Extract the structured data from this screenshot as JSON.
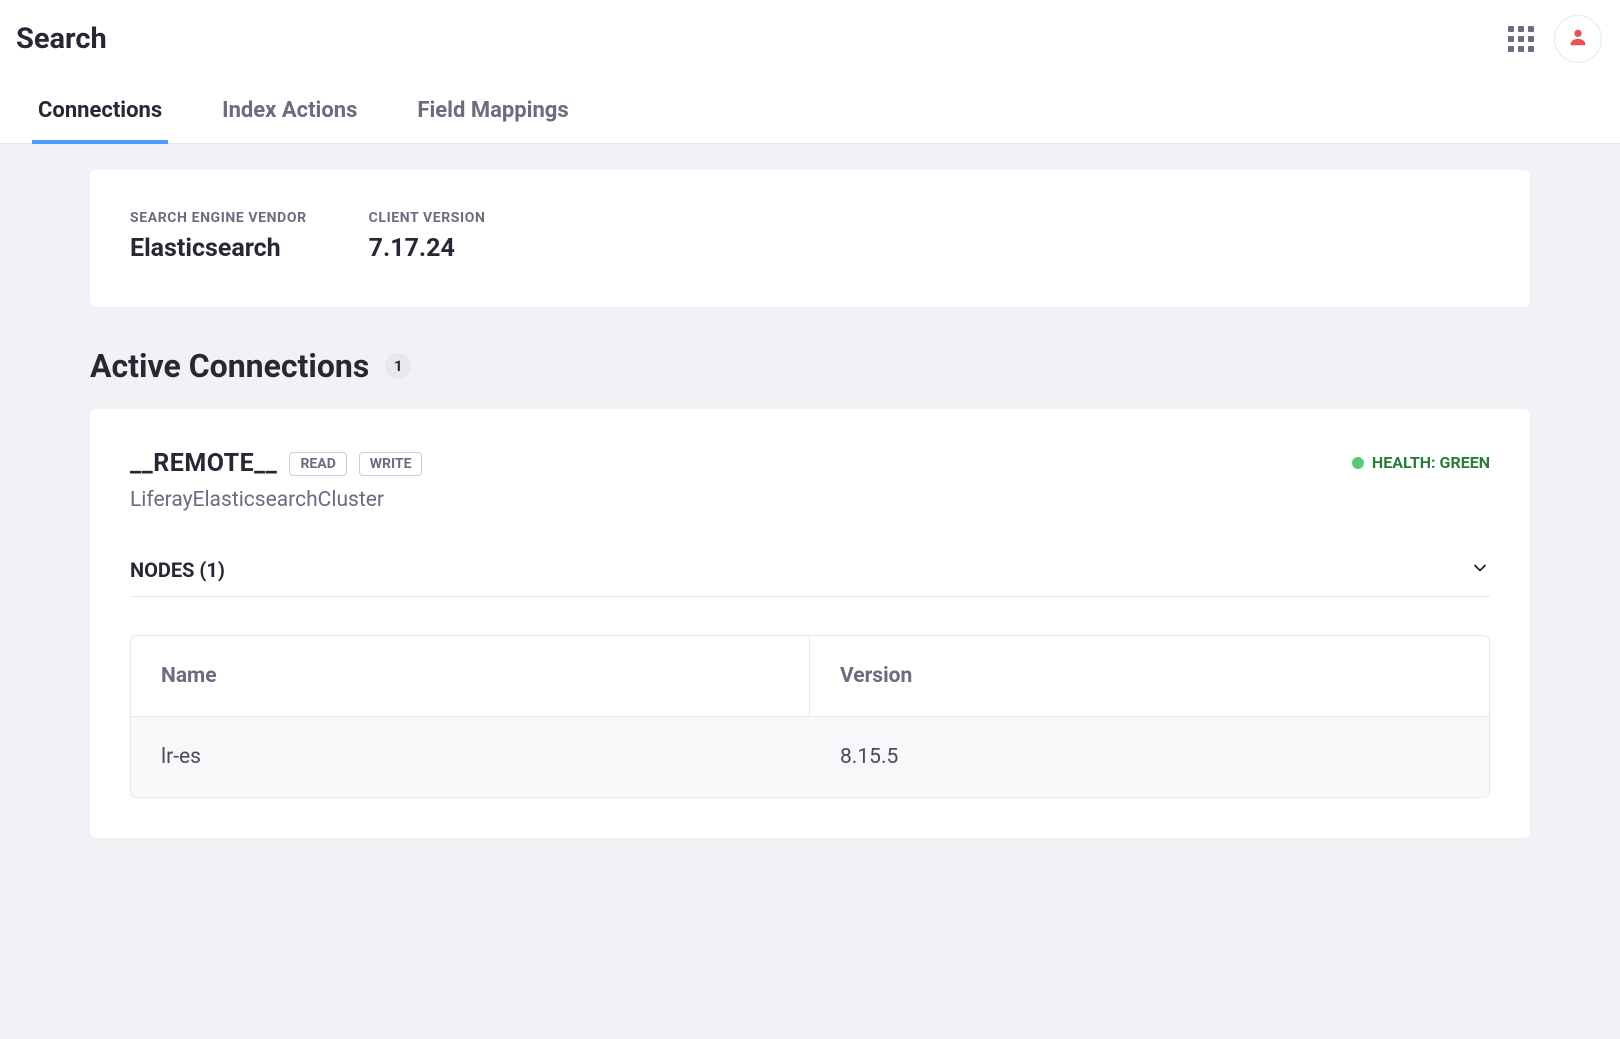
{
  "header": {
    "title": "Search"
  },
  "tabs": [
    {
      "label": "Connections",
      "active": true
    },
    {
      "label": "Index Actions",
      "active": false
    },
    {
      "label": "Field Mappings",
      "active": false
    }
  ],
  "engine": {
    "vendor_label": "SEARCH ENGINE VENDOR",
    "vendor_value": "Elasticsearch",
    "client_label": "CLIENT VERSION",
    "client_value": "7.17.24"
  },
  "active_connections": {
    "title": "Active Connections",
    "count": "1"
  },
  "connection": {
    "name": "__REMOTE__",
    "pills": [
      "READ",
      "WRITE"
    ],
    "cluster": "LiferayElasticsearchCluster",
    "health_label": "HEALTH: GREEN",
    "nodes_title": "NODES (1)",
    "table": {
      "headers": [
        "Name",
        "Version"
      ],
      "rows": [
        {
          "name": "lr-es",
          "version": "8.15.5"
        }
      ]
    }
  }
}
